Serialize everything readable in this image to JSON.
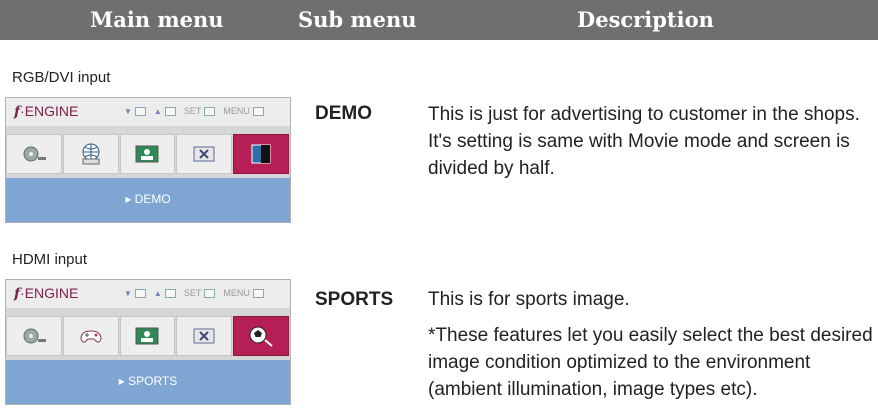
{
  "header": {
    "main_menu": "Main menu",
    "sub_menu": "Sub menu",
    "description": "Description"
  },
  "osd": {
    "brand": "ENGINE",
    "set": "SET",
    "menu": "MENU"
  },
  "sections": [
    {
      "label": "RGB/DVI input",
      "submenu": "▸ DEMO",
      "icons": [
        "movie-reel-icon",
        "globe-www-icon",
        "picture-icon",
        "close-box-icon",
        "demo-half-icon"
      ],
      "active_index": 4,
      "term": "DEMO",
      "description_lines": [
        "This is just for advertising to customer in the shops.",
        "It's setting is same with Movie mode and screen is",
        "divided by half."
      ]
    },
    {
      "label": "HDMI input",
      "submenu": "▸ SPORTS",
      "icons": [
        "movie-reel-icon",
        "gamepad-icon",
        "picture-icon",
        "close-box-icon",
        "sports-ball-icon"
      ],
      "active_index": 4,
      "term": "SPORTS",
      "description_lines": [
        "This is for sports image.",
        "*These features let you easily select the best desired",
        "image condition optimized to the environment",
        "(ambient illumination, image types etc)."
      ]
    }
  ],
  "colors": {
    "header_bg": "#6f6f6f",
    "active_icon": "#b51f55",
    "submenu_bar": "#7fa6d3"
  }
}
